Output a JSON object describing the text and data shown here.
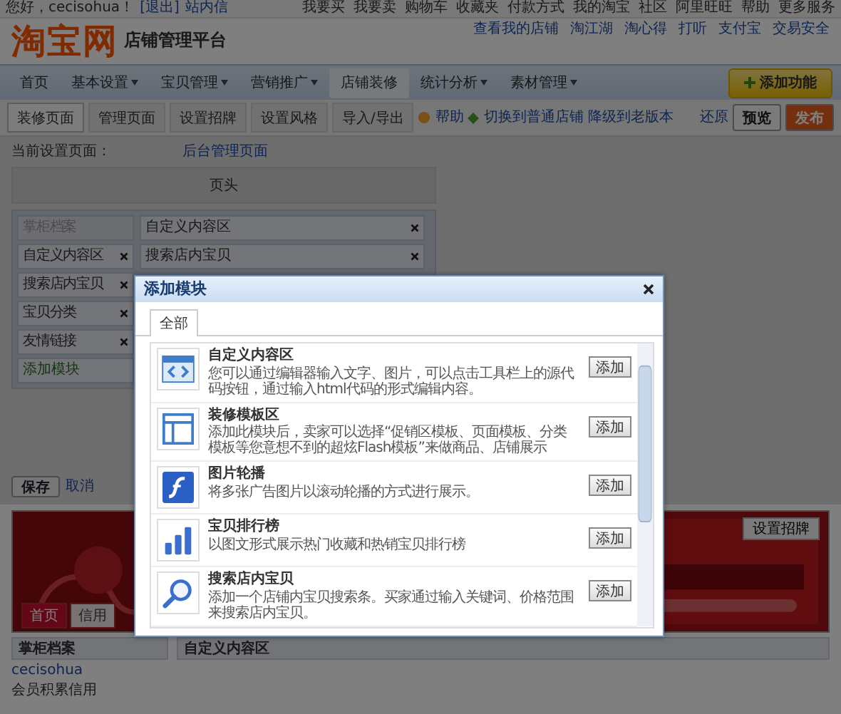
{
  "top_bar": {
    "greeting": "您好，cecisohua！",
    "logout": "[退出]",
    "messages": "站内信",
    "links": [
      "我要买",
      "我要卖",
      "购物车",
      "收藏夹",
      "付款方式",
      "我的淘宝",
      "社区",
      "阿里旺旺",
      "帮助",
      "更多服务"
    ]
  },
  "header": {
    "logo": "淘宝网",
    "subtitle": "店铺管理平台",
    "links": [
      "查看我的店铺",
      "淘江湖",
      "淘心得",
      "打听",
      "支付宝",
      "交易安全"
    ]
  },
  "nav": {
    "items": [
      {
        "label": "首页",
        "dropdown": false,
        "selected": false
      },
      {
        "label": "基本设置",
        "dropdown": true,
        "selected": false
      },
      {
        "label": "宝贝管理",
        "dropdown": true,
        "selected": false
      },
      {
        "label": "营销推广",
        "dropdown": true,
        "selected": false
      },
      {
        "label": "店铺装修",
        "dropdown": false,
        "selected": true
      },
      {
        "label": "统计分析",
        "dropdown": true,
        "selected": false
      },
      {
        "label": "素材管理",
        "dropdown": true,
        "selected": false
      }
    ],
    "add_button": "添加功能"
  },
  "subnav": {
    "tabs": [
      {
        "label": "装修页面",
        "selected": true
      },
      {
        "label": "管理页面",
        "selected": false
      },
      {
        "label": "设置招牌",
        "selected": false
      },
      {
        "label": "设置风格",
        "selected": false
      },
      {
        "label": "导入/导出",
        "selected": false
      }
    ],
    "help": "帮助",
    "switch": "切换到普通店铺",
    "downgrade": "降级到老版本",
    "restore": "还原",
    "preview": "预览",
    "publish": "发布"
  },
  "editor": {
    "current_label": "当前设置页面：",
    "current_page": "后台管理页面",
    "header_block": "页头",
    "left_modules": [
      {
        "name": "掌柜档案",
        "kind": "fixed"
      },
      {
        "name": "自定义内容区",
        "kind": "module"
      },
      {
        "name": "搜索店内宝贝",
        "kind": "module"
      },
      {
        "name": "宝贝分类",
        "kind": "module"
      },
      {
        "name": "友情链接",
        "kind": "module"
      }
    ],
    "add_module": "添加模块",
    "right_modules": [
      "自定义内容区",
      "搜索店内宝贝"
    ],
    "save": "保存",
    "cancel": "取消"
  },
  "banner": {
    "set_sign": "设置招牌",
    "tabs": [
      {
        "label": "首页",
        "selected": true
      },
      {
        "label": "信用",
        "selected": false
      }
    ]
  },
  "bottom": {
    "profile_title": "掌柜档案",
    "user": "cecisohua",
    "credit": "会员积累信用",
    "content_title": "自定义内容区"
  },
  "dialog": {
    "title": "添加模块",
    "tabs": [
      {
        "label": "全部",
        "selected": true
      }
    ],
    "modules": [
      {
        "kind": "code",
        "title": "自定义内容区",
        "description": "您可以通过编辑器输入文字、图片，可以点击工具栏上的源代码按钮，通过输入html代码的形式编辑内容。",
        "button": "添加"
      },
      {
        "kind": "layout",
        "title": "装修模板区",
        "description": "添加此模块后，卖家可以选择“促销区模板、页面模板、分类模板等您意想不到的超炫Flash模板”来做商品、店铺展示",
        "button": "添加"
      },
      {
        "kind": "flash",
        "title": "图片轮播",
        "description": "将多张广告图片以滚动轮播的方式进行展示。",
        "button": "添加"
      },
      {
        "kind": "chart",
        "title": "宝贝排行榜",
        "description": "以图文形式展示热门收藏和热销宝贝排行榜",
        "button": "添加"
      },
      {
        "kind": "search",
        "title": "搜索店内宝贝",
        "description": "添加一个店铺内宝贝搜索条。买家通过输入关键词、价格范围来搜索店内宝贝。",
        "button": "添加"
      }
    ]
  }
}
